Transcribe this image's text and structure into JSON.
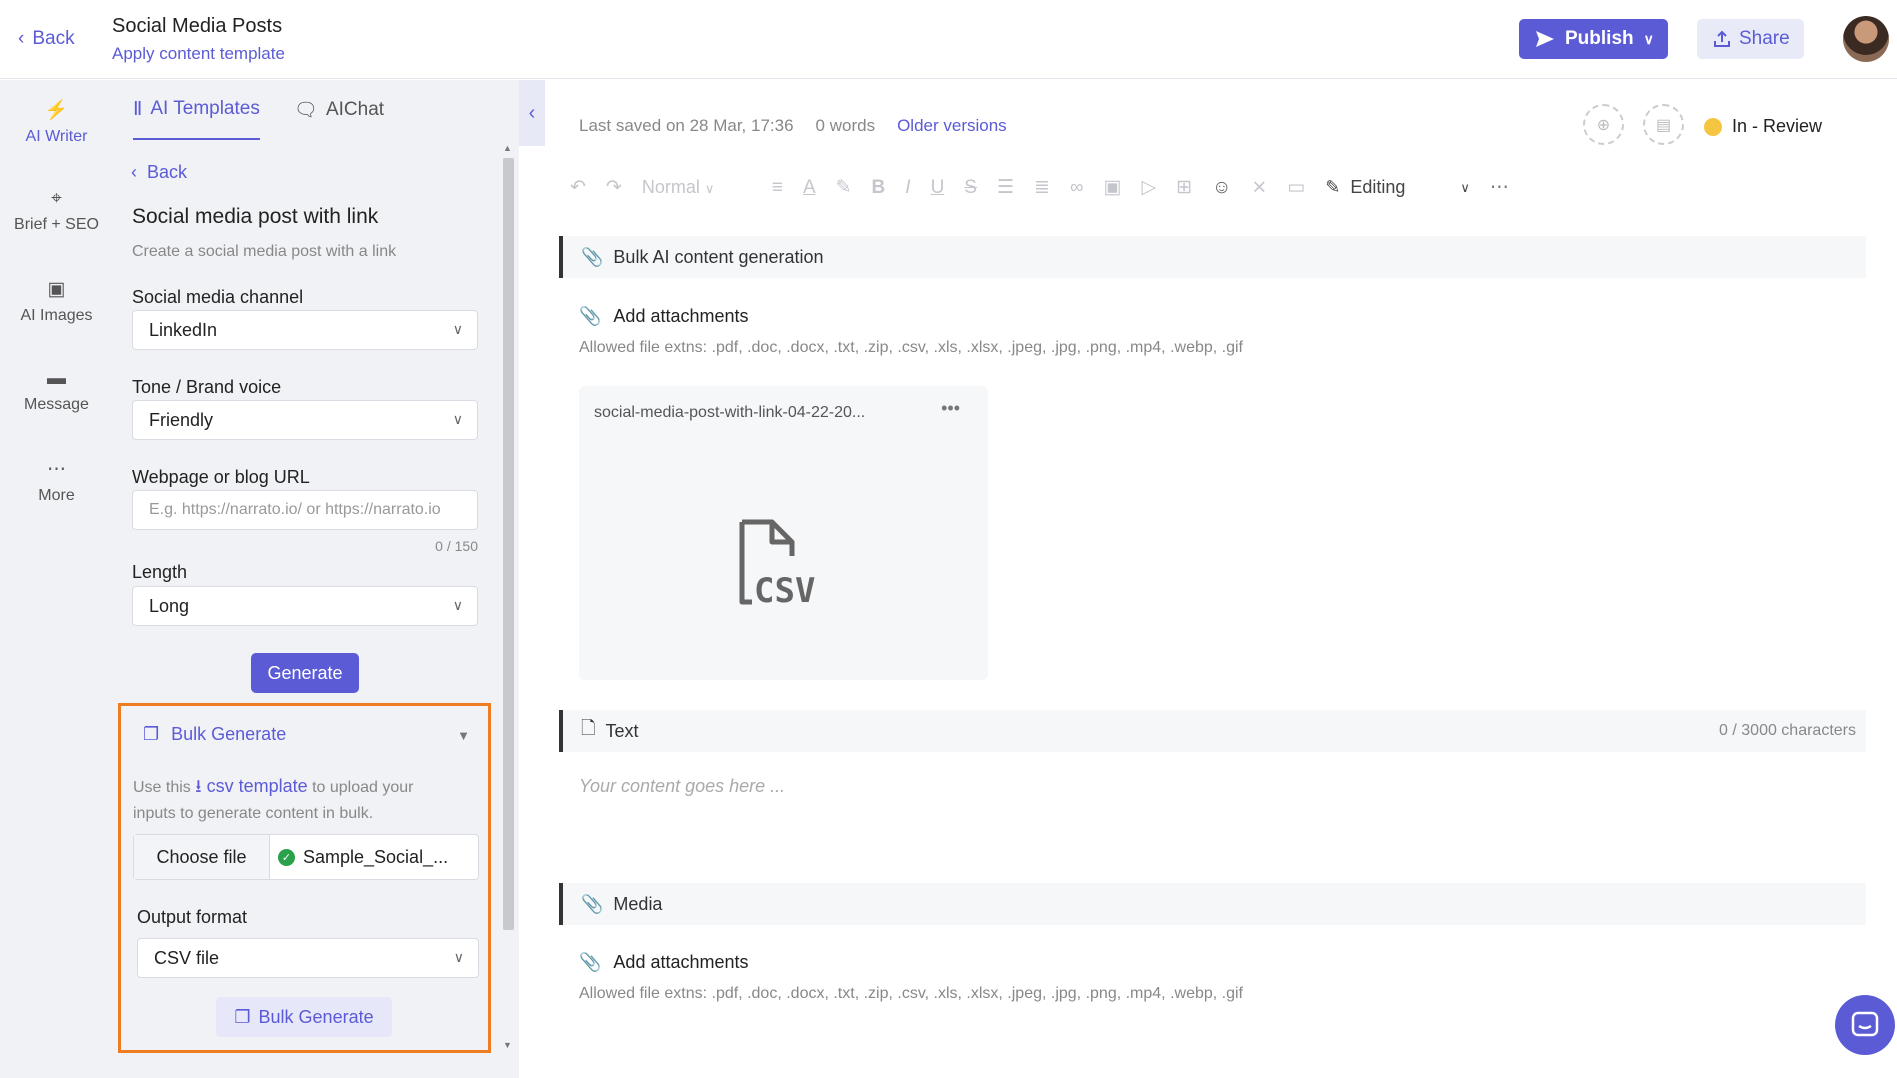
{
  "header": {
    "back_label": "Back",
    "title": "Social Media Posts",
    "subtitle": "Apply content template",
    "publish_label": "Publish",
    "share_label": "Share"
  },
  "rail": {
    "items": [
      {
        "label": "AI Writer",
        "icon": "lightning-icon"
      },
      {
        "label": "Brief + SEO",
        "icon": "crosshair-icon"
      },
      {
        "label": "AI Images",
        "icon": "image-icon"
      },
      {
        "label": "Message",
        "icon": "message-icon"
      },
      {
        "label": "More",
        "icon": "more-icon"
      }
    ]
  },
  "panel": {
    "tabs": [
      {
        "label": "AI Templates"
      },
      {
        "label": "AIChat"
      }
    ],
    "back_label": "Back",
    "template_title": "Social media post with link",
    "template_desc": "Create a social media post with a link",
    "channel_label": "Social media channel",
    "channel_value": "LinkedIn",
    "tone_label": "Tone / Brand voice",
    "tone_value": "Friendly",
    "url_label": "Webpage or blog URL",
    "url_placeholder": "E.g. https://narrato.io/ or https://narrato.io",
    "url_counter": "0 / 150",
    "length_label": "Length",
    "length_value": "Long",
    "generate_label": "Generate",
    "bulk": {
      "title": "Bulk Generate",
      "info_pre": "Use this",
      "info_link": "csv template",
      "info_post": "to upload your inputs to generate content in bulk.",
      "choose_label": "Choose file",
      "file_name": "Sample_Social_...",
      "output_label": "Output format",
      "output_value": "CSV file",
      "button_label": "Bulk Generate"
    }
  },
  "editor": {
    "last_saved": "Last saved on 28 Mar, 17:36",
    "words": "0 words",
    "older_versions": "Older versions",
    "status": "In - Review",
    "toolbar_style": "Normal",
    "mode": "Editing",
    "sections": {
      "bulk_title": "Bulk AI content generation",
      "add_attachments": "Add attachments",
      "allowed": "Allowed file extns: .pdf, .doc, .docx, .txt, .zip, .csv, .xls, .xlsx, .jpeg, .jpg, .png, .mp4, .webp, .gif",
      "file_card_name": "social-media-post-with-link-04-22-20...",
      "text_title": "Text",
      "text_counter": "0 / 3000 characters",
      "text_placeholder": "Your content goes here ...",
      "media_title": "Media",
      "media_add": "Add attachments",
      "media_allowed": "Allowed file extns: .pdf, .doc, .docx, .txt, .zip, .csv, .xls, .xlsx, .jpeg, .jpg, .png, .mp4, .webp, .gif"
    }
  },
  "colors": {
    "accent": "#5b5bd6",
    "highlight": "#f07c22",
    "status": "#f5c542"
  }
}
